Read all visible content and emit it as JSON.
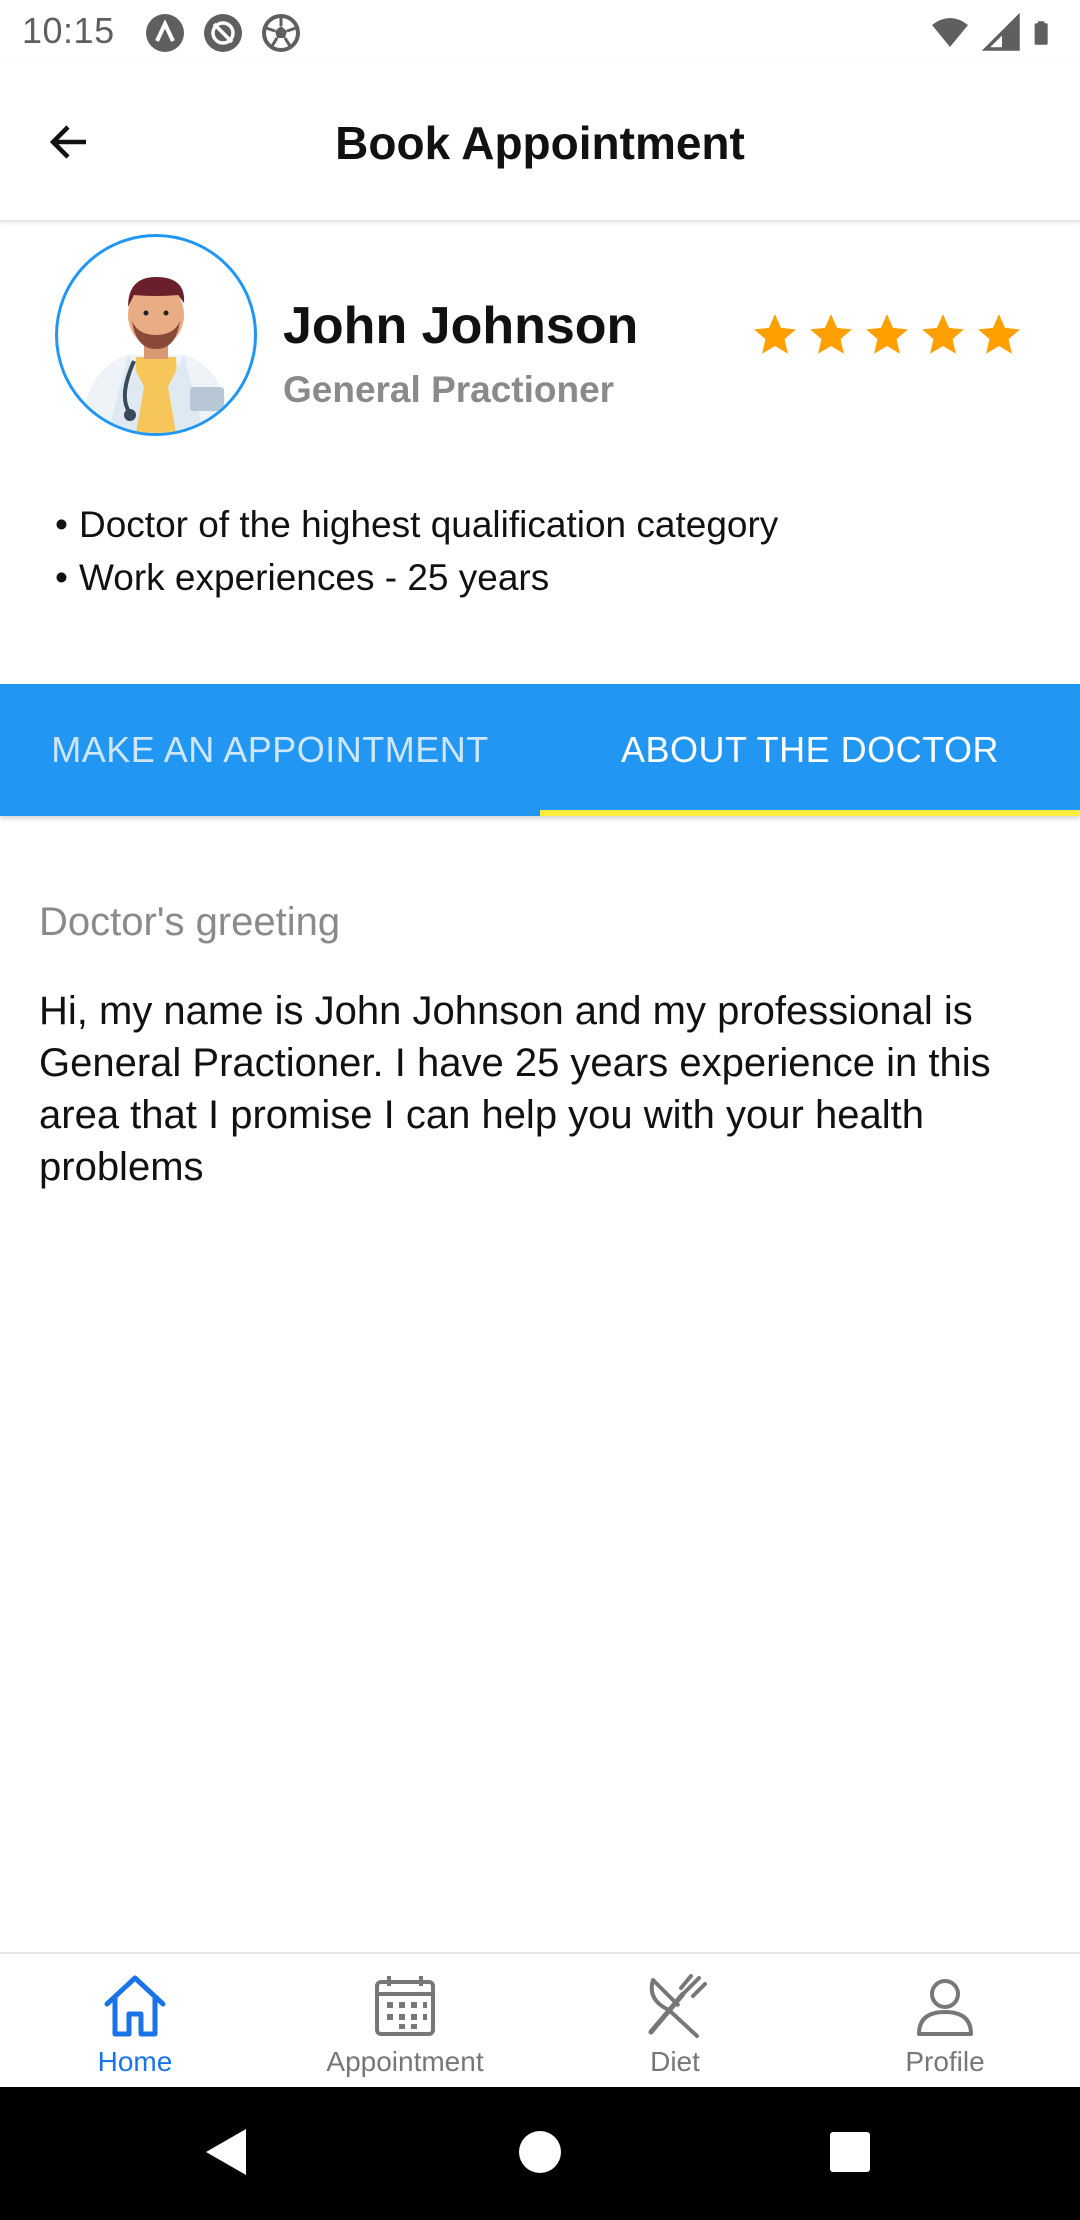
{
  "status_bar": {
    "time": "10:15",
    "left_icons": [
      "a-icon",
      "no-sync-icon",
      "soccer-ball-icon"
    ],
    "right_icons": [
      "wifi-icon",
      "signal-icon",
      "battery-icon"
    ]
  },
  "app_bar": {
    "title": "Book Appointment",
    "back_icon": "arrow-back-icon"
  },
  "doctor": {
    "name": "John Johnson",
    "specialty": "General Practioner",
    "rating": 5,
    "rating_max": 5,
    "star_color": "#ff9f00",
    "avatar_icon": "doctor-avatar-icon",
    "qualifications": [
      "Doctor of the highest qualification category",
      "Work experiences - 25 years"
    ]
  },
  "tabs": [
    {
      "label": "MAKE AN APPOINTMENT",
      "active": false
    },
    {
      "label": "ABOUT THE DOCTOR",
      "active": true
    }
  ],
  "about": {
    "greeting_label": "Doctor's greeting",
    "greeting_text": "Hi, my name is John Johnson and my professional is General Practioner. I have 25 years experience in this area that I promise I can help you with your health problems"
  },
  "bottom_nav": [
    {
      "label": "Home",
      "icon": "home-icon",
      "active": true
    },
    {
      "label": "Appointment",
      "icon": "calendar-icon",
      "active": false
    },
    {
      "label": "Diet",
      "icon": "fork-knife-icon",
      "active": false
    },
    {
      "label": "Profile",
      "icon": "person-icon",
      "active": false
    }
  ],
  "colors": {
    "primary": "#2196f3",
    "tab_indicator": "#ffeb3b",
    "active_nav": "#1a73e8"
  }
}
